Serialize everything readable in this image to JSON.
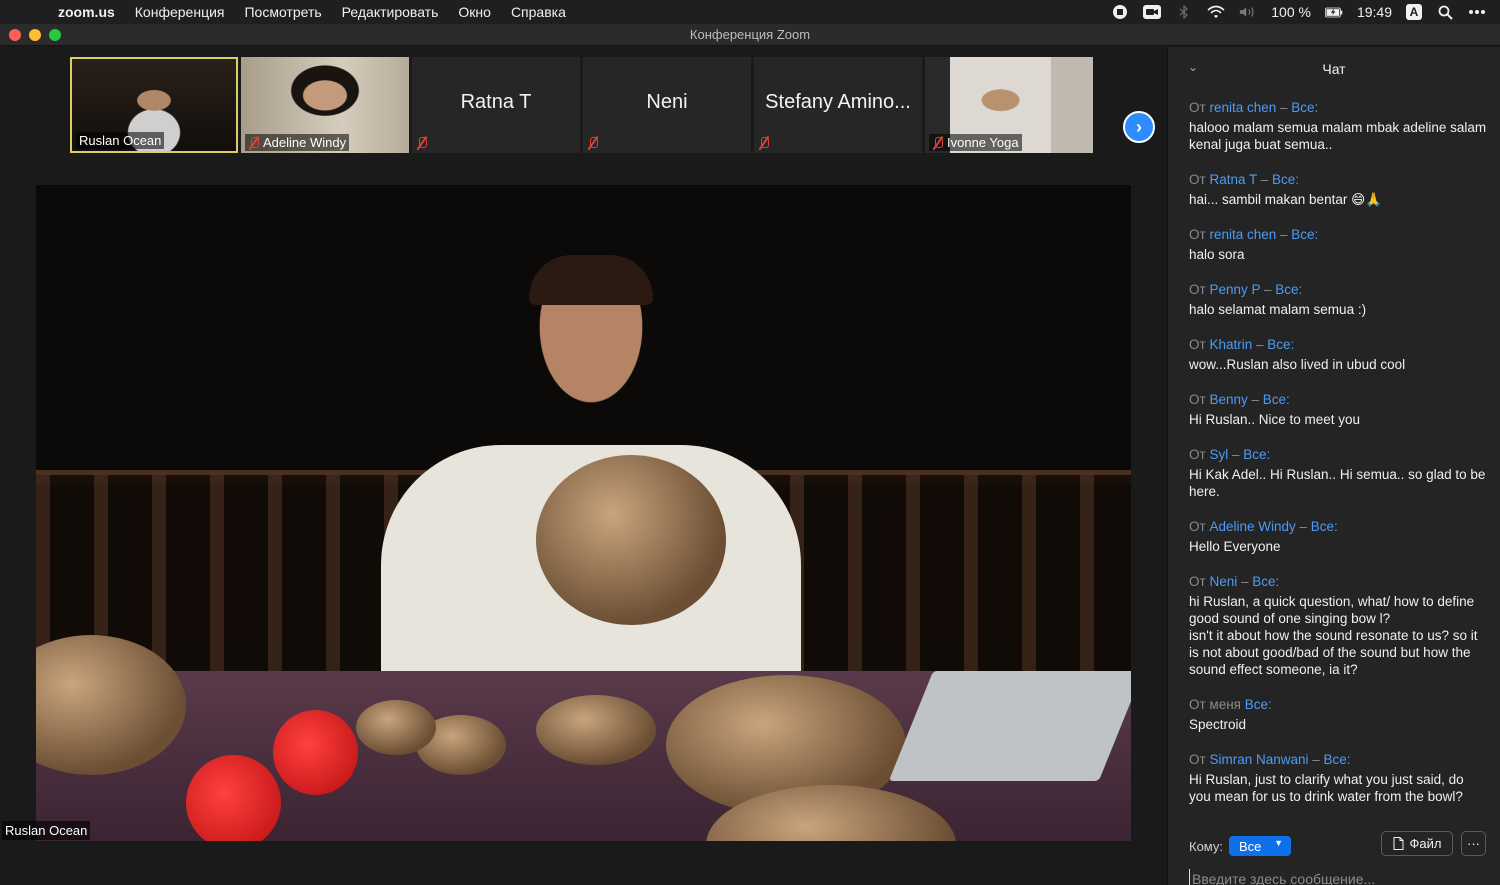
{
  "menubar": {
    "apple_icon": "apple-icon",
    "app_name": "zoom.us",
    "items": [
      "Конференция",
      "Посмотреть",
      "Редактировать",
      "Окно",
      "Справка"
    ],
    "battery": "100 %",
    "time": "19:49",
    "input_source": "A"
  },
  "window": {
    "title": "Конференция Zoom"
  },
  "participants": [
    {
      "name": "Ruslan Ocean",
      "video": true,
      "muted": false,
      "active": true
    },
    {
      "name": "Adeline Windy",
      "video": true,
      "muted": true,
      "active": false
    },
    {
      "name": "Ratna T",
      "video": false,
      "muted": true,
      "active": false
    },
    {
      "name": "Neni",
      "video": false,
      "muted": true,
      "active": false
    },
    {
      "name": "Stefany Amino...",
      "video": false,
      "muted": true,
      "active": false
    },
    {
      "name": "Ivonne Yoga",
      "video": true,
      "muted": true,
      "active": false
    }
  ],
  "main_speaker": {
    "name": "Ruslan Ocean"
  },
  "chat": {
    "title": "Чат",
    "messages": [
      {
        "prefix": "От",
        "sender": "renita chen",
        "to": "Все:",
        "text": "halooo malam semua malam mbak adeline salam kenal juga buat semua.."
      },
      {
        "prefix": "От",
        "sender": "Ratna T",
        "to": "Все:",
        "text": "hai... sambil makan bentar 😄🙏"
      },
      {
        "prefix": "От",
        "sender": "renita chen",
        "to": "Все:",
        "text": "halo sora"
      },
      {
        "prefix": "От",
        "sender": "Penny P",
        "to": "Все:",
        "text": "halo selamat malam semua :)"
      },
      {
        "prefix": "От",
        "sender": "Khatrin",
        "to": "Все:",
        "text": "wow...Ruslan also lived in ubud cool"
      },
      {
        "prefix": "От",
        "sender": "Benny",
        "to": "Все:",
        "text": "Hi Ruslan.. Nice to meet you"
      },
      {
        "prefix": "От",
        "sender": "Syl",
        "to": "Все:",
        "text": "Hi Kak Adel.. Hi Ruslan.. Hi semua.. so glad to be here."
      },
      {
        "prefix": "От",
        "sender": "Adeline Windy",
        "to": "Все:",
        "text": "Hello Everyone"
      },
      {
        "prefix": "От",
        "sender": "Neni",
        "to": "Все:",
        "text": "hi Ruslan,  a quick question, what/ how to define good sound of one singing bow l?\nisn't it about how the sound resonate to us? so it is not about good/bad of the sound but how the sound effect someone, ia it?"
      },
      {
        "prefix": "От меня",
        "sender": "",
        "to": "Все:",
        "text": "Spectroid"
      },
      {
        "prefix": "От",
        "sender": "Simran Nanwani",
        "to": "Все:",
        "text": "Hi Ruslan, just to clarify what you just said, do you mean for us to drink water from the bowl?"
      }
    ],
    "to_label": "Кому:",
    "to_value": "Все",
    "file_label": "Файл",
    "more_label": "···",
    "input_placeholder": "Введите здесь сообщение..."
  },
  "colors": {
    "accent": "#2d8cff",
    "active_speaker_border": "#d9cd63",
    "muted_icon": "#e0403a",
    "chat_link": "#4c9bf5"
  }
}
